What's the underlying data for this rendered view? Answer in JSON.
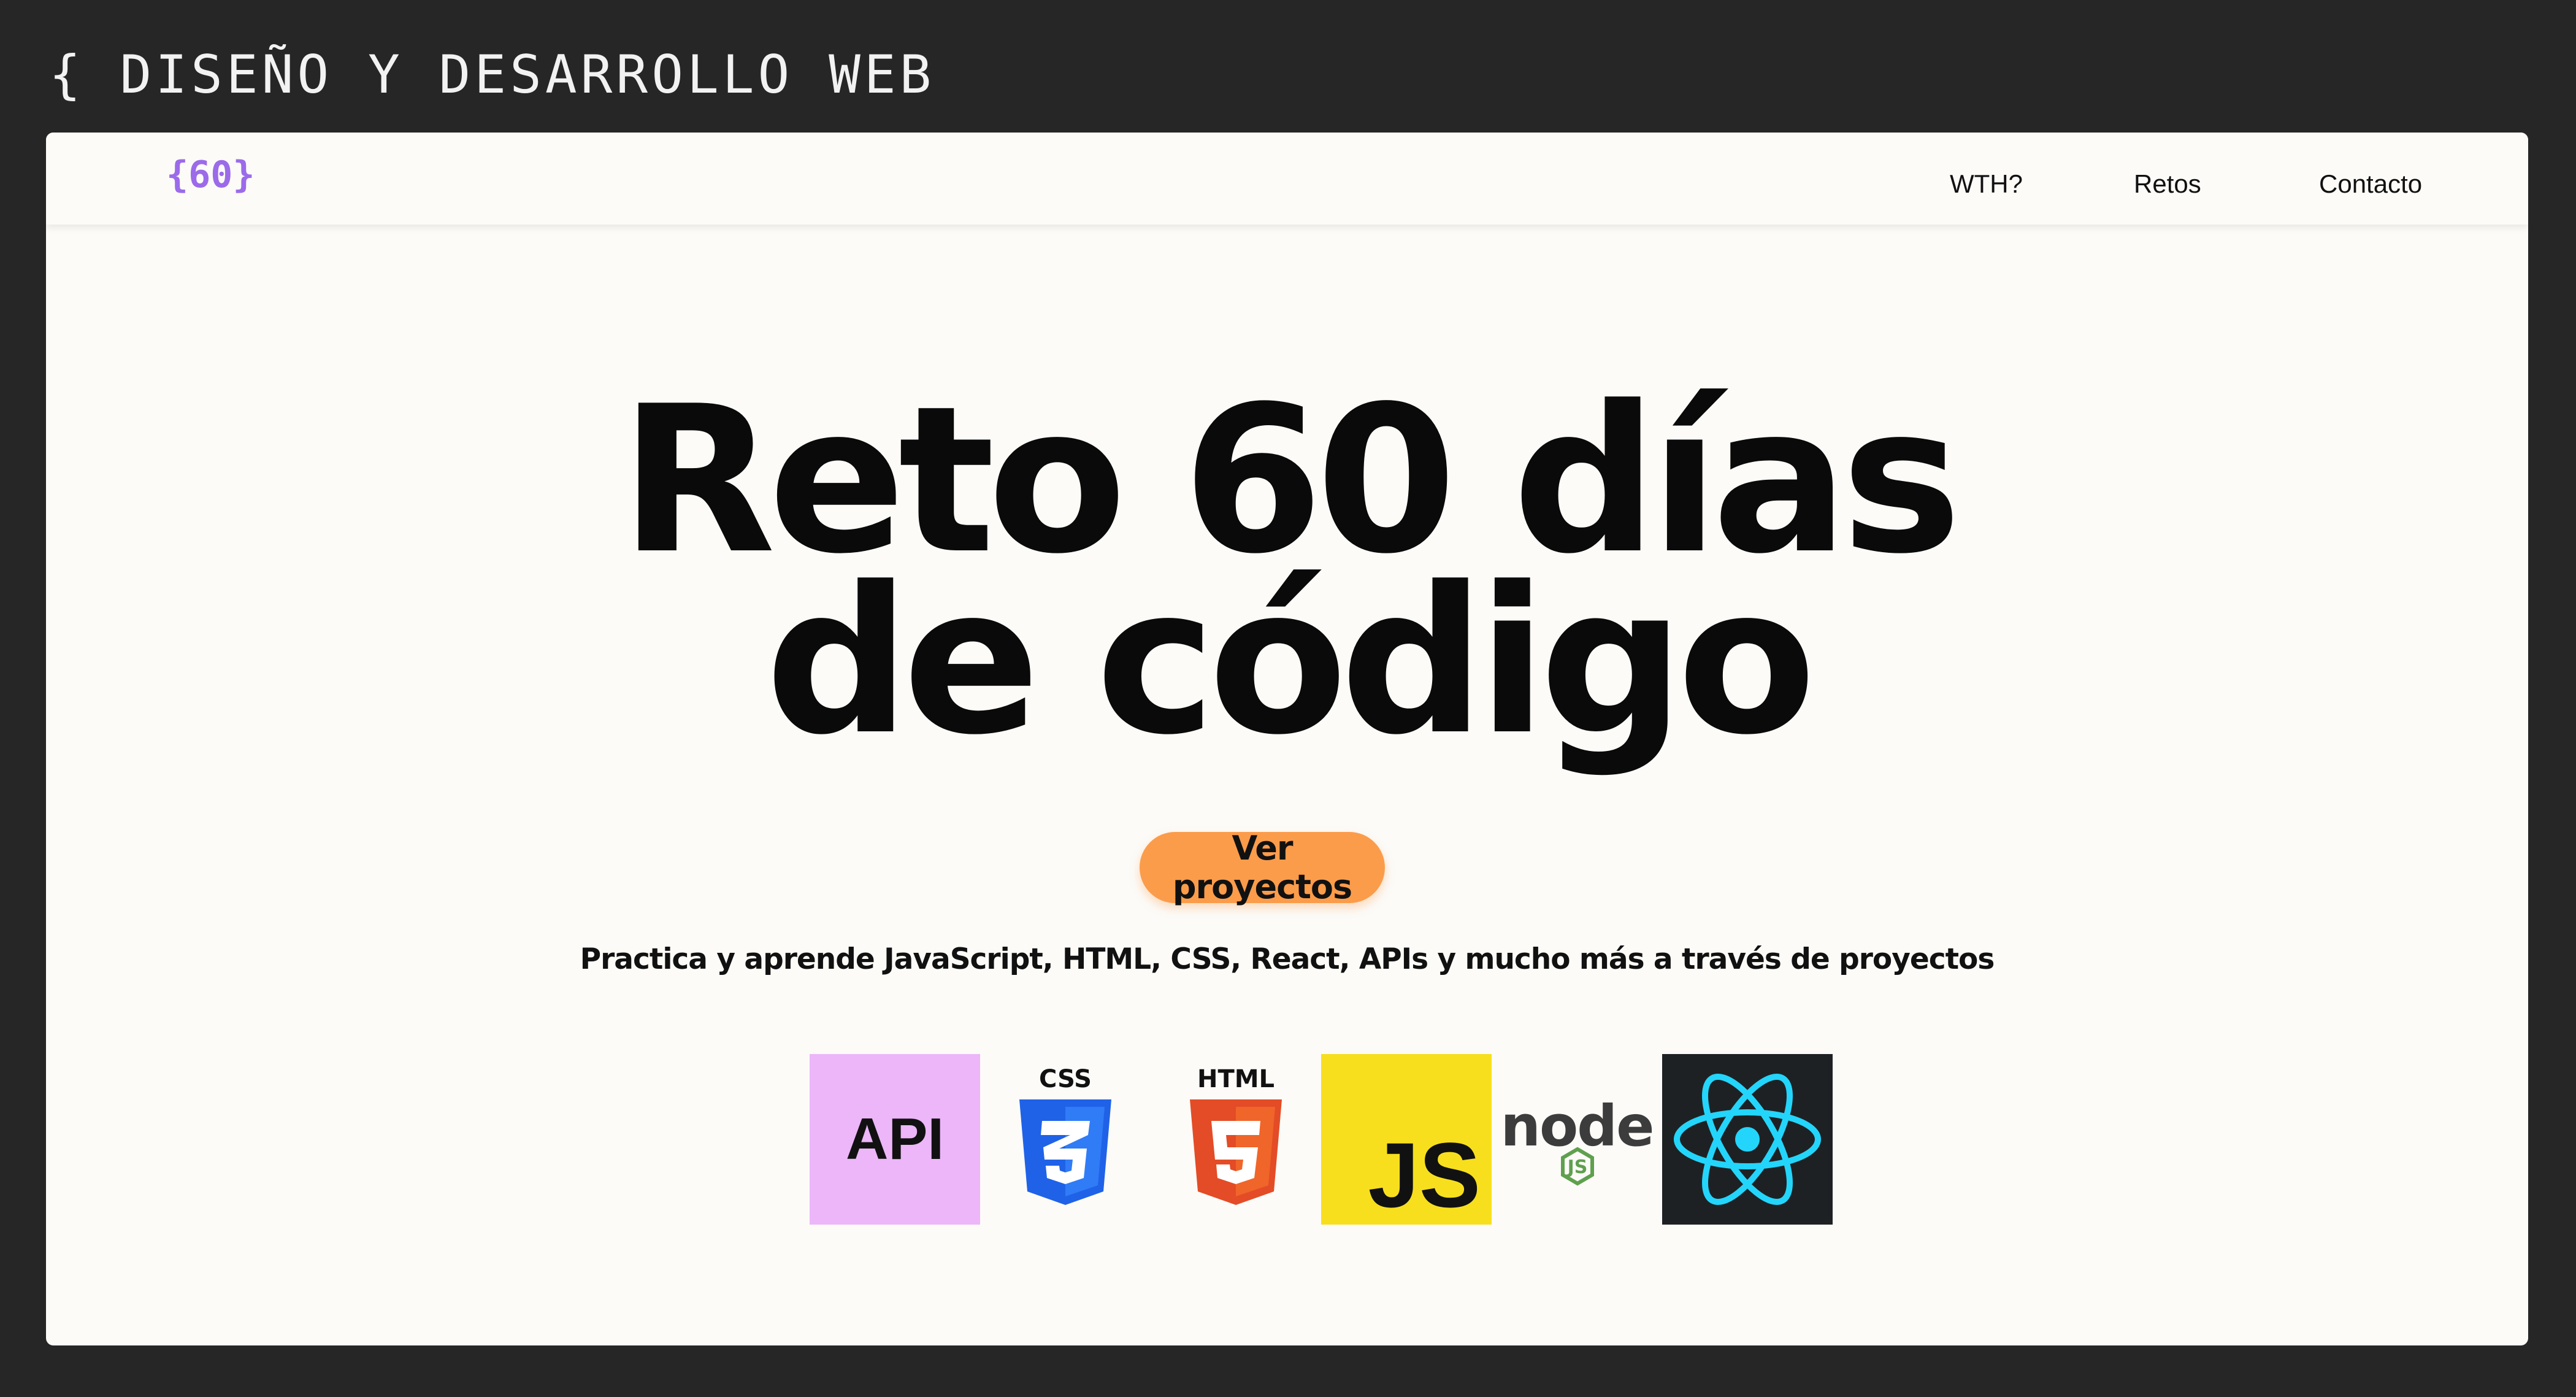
{
  "caption": "{ DISEÑO Y DESARROLLO WEB",
  "nav": {
    "logo": "{60}",
    "links": [
      "WTH?",
      "Retos",
      "Contacto"
    ]
  },
  "hero": {
    "title_line1": "Reto 60 días",
    "title_line2": "de código",
    "cta_label": "Ver proyectos",
    "tagline": "Practica y aprende JavaScript, HTML, CSS, React, APIs y mucho más a través de proyectos"
  },
  "tech_tiles": [
    {
      "name": "api",
      "label": "API",
      "bg": "#ecb6f9"
    },
    {
      "name": "css",
      "label": "CSS",
      "bg": "#fcfbf8"
    },
    {
      "name": "html",
      "label": "HTML",
      "bg": "#fcfbf8"
    },
    {
      "name": "js",
      "label": "JS",
      "bg": "#f7df1e"
    },
    {
      "name": "node",
      "label": "node",
      "sublabel": "JS",
      "bg": "#fcfbf8"
    },
    {
      "name": "react",
      "label": "",
      "bg": "#1e2124"
    }
  ],
  "colors": {
    "frame": "#262626",
    "page": "#fcfbf8",
    "logo": "#9b6bea",
    "cta": "#fb9c4b",
    "react_cyan": "#23d5fb"
  }
}
